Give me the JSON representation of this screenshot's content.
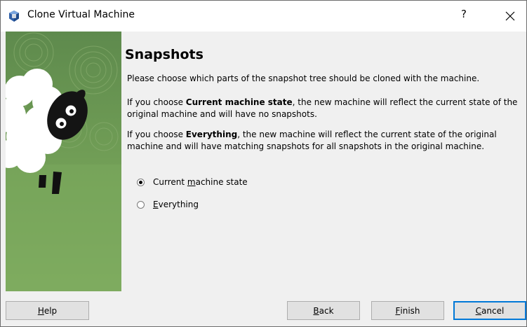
{
  "window": {
    "title": "Clone Virtual Machine",
    "help_glyph": "?",
    "close_glyph": "✕"
  },
  "page": {
    "heading": "Snapshots",
    "intro": "Please choose which parts of the snapshot tree should be cloned with the machine.",
    "p2_prefix": "If you choose ",
    "p2_bold": "Current machine state",
    "p2_suffix": ", the new machine will reflect the current state of the original machine and will have no snapshots.",
    "p3_prefix": "If you choose ",
    "p3_bold": "Everything",
    "p3_suffix": ", the new machine will reflect the current state of the original machine and will have matching snapshots for all snapshots in the original machine."
  },
  "options": {
    "current": {
      "pre": "Current ",
      "accel": "m",
      "post": "achine state",
      "selected": true
    },
    "everything": {
      "pre": "",
      "accel": "E",
      "post": "verything",
      "selected": false
    }
  },
  "buttons": {
    "help": {
      "accel": "H",
      "rest": "elp"
    },
    "back": {
      "accel": "B",
      "rest": "ack"
    },
    "finish": {
      "accel": "F",
      "rest": "inish"
    },
    "cancel": {
      "accel": "C",
      "rest": "ancel"
    }
  },
  "colors": {
    "window_bg": "#f0f0f0",
    "art_green": "#6f9c55",
    "focus_border": "#0078d7"
  }
}
